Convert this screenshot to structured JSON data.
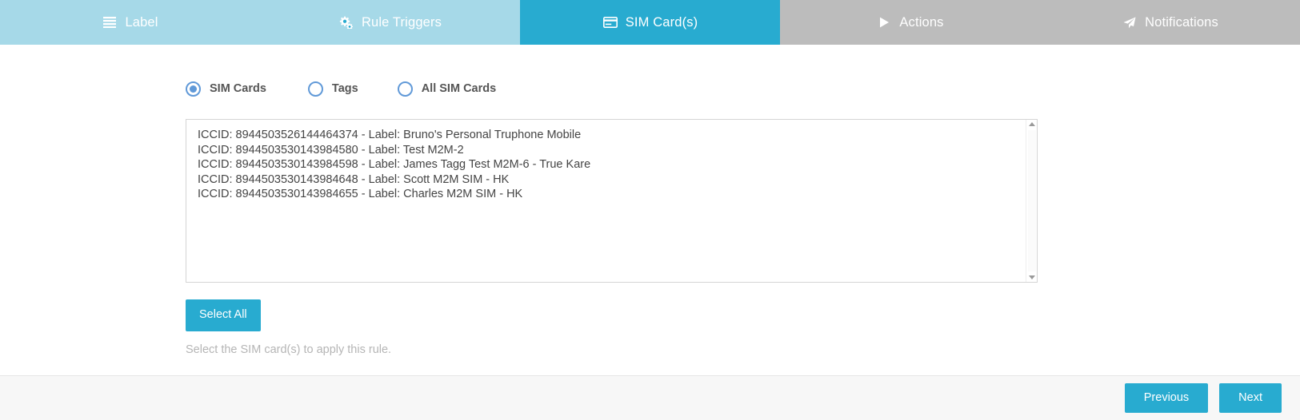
{
  "wizard": {
    "tabs": [
      {
        "label": "Label",
        "icon": "list-icon",
        "state": "done"
      },
      {
        "label": "Rule Triggers",
        "icon": "gears-icon",
        "state": "done"
      },
      {
        "label": "SIM Card(s)",
        "icon": "credit-card-icon",
        "state": "active"
      },
      {
        "label": "Actions",
        "icon": "play-icon",
        "state": "future"
      },
      {
        "label": "Notifications",
        "icon": "paper-plane-icon",
        "state": "future"
      }
    ],
    "colors": {
      "tab_done": "#a6d9e8",
      "tab_active": "#28abd0",
      "tab_future": "#bcbcbc",
      "button_primary": "#28abd0",
      "radio_accent": "#6099d8",
      "help_text": "#b5b5b5"
    }
  },
  "selection_mode": {
    "options": [
      {
        "label": "SIM Cards",
        "selected": true
      },
      {
        "label": "Tags",
        "selected": false
      },
      {
        "label": "All SIM Cards",
        "selected": false
      }
    ]
  },
  "sim_list": {
    "items": [
      "ICCID: 8944503526144464374 - Label: Bruno's Personal Truphone Mobile",
      "ICCID: 8944503530143984580 - Label: Test M2M-2",
      "ICCID: 8944503530143984598 - Label: James Tagg Test M2M-6 - True Kare",
      "ICCID: 8944503530143984648 - Label: Scott M2M SIM - HK",
      "ICCID: 8944503530143984655 - Label: Charles M2M SIM - HK"
    ]
  },
  "actions": {
    "select_all_label": "Select All",
    "help_text": "Select the SIM card(s) to apply this rule."
  },
  "footer": {
    "previous_label": "Previous",
    "next_label": "Next"
  }
}
